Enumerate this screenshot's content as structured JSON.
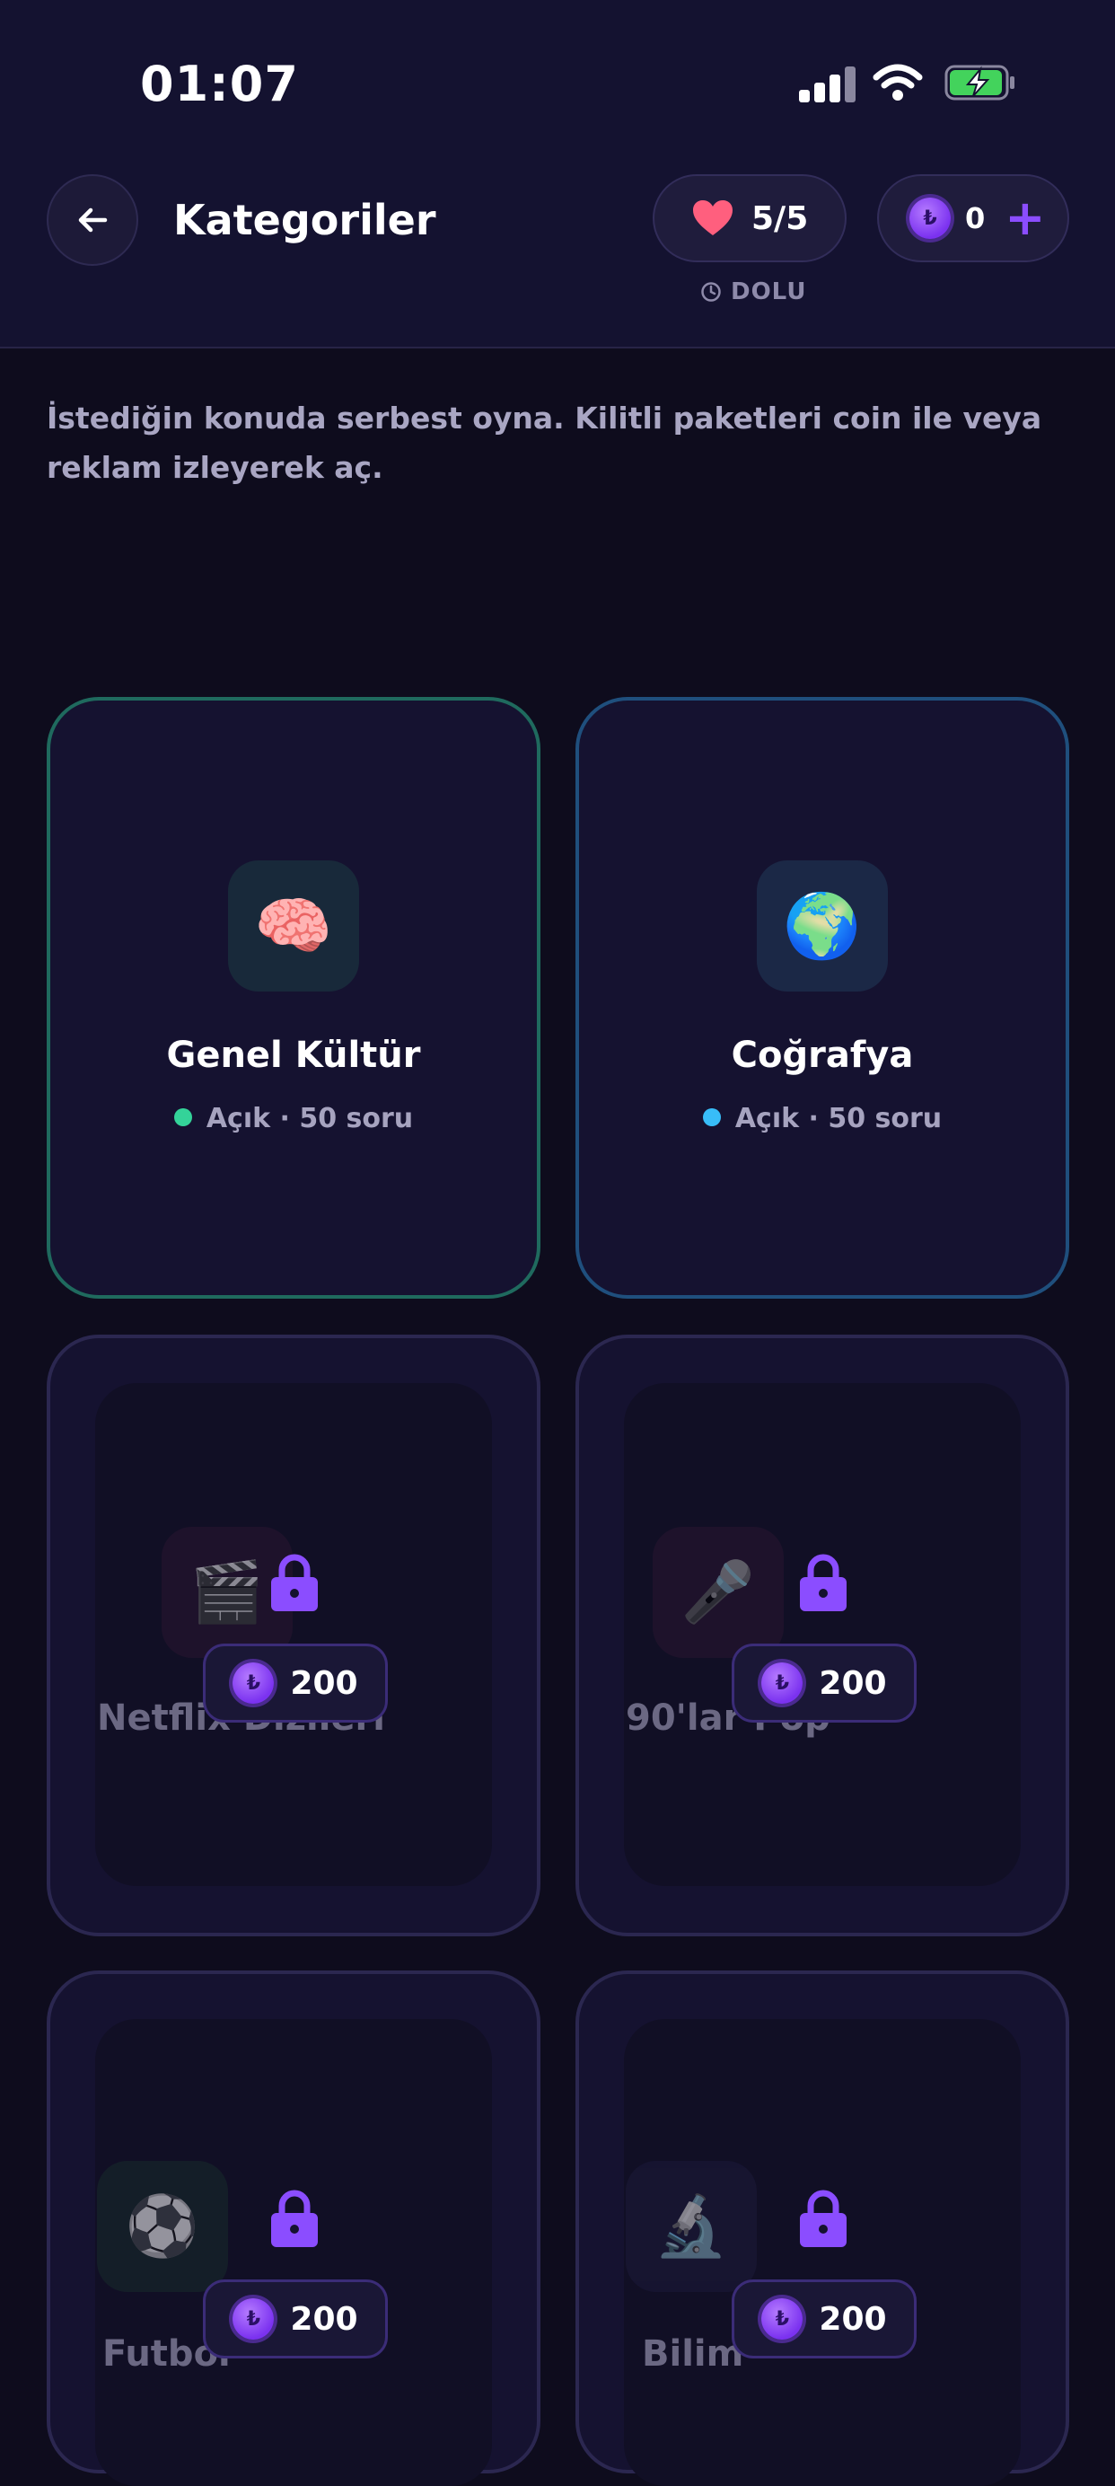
{
  "status_bar": {
    "time": "01:07"
  },
  "header": {
    "title": "Kategoriler",
    "lives": "5/5",
    "lives_status": "DOLU",
    "coins": "0",
    "add_coins_label": "+"
  },
  "intro_text": "İstediğin konuda serbest oyna. Kilitli paketleri coin ile veya reklam izleyerek aç.",
  "colors": {
    "accent": "#8b4dff",
    "open_green": "#34d399",
    "open_blue": "#38bdf8",
    "heart": "#ff5f7e"
  },
  "categories": [
    {
      "name": "Genel Kültür",
      "icon": "brain-icon",
      "emoji": "🧠",
      "status": "Açık · 50 soru",
      "locked": false
    },
    {
      "name": "Coğrafya",
      "icon": "globe-icon",
      "emoji": "🌍",
      "status": "Açık · 50 soru",
      "locked": false
    },
    {
      "name": "Netflix Dizileri",
      "icon": "clapperboard-icon",
      "emoji": "🎬",
      "price": "200",
      "locked": true
    },
    {
      "name": "90'lar Pop",
      "icon": "microphone-icon",
      "emoji": "🎤",
      "price": "200",
      "locked": true
    },
    {
      "name": "Futbol",
      "icon": "soccer-ball-icon",
      "emoji": "⚽",
      "price": "200",
      "locked": true
    },
    {
      "name": "Bilim",
      "icon": "microscope-icon",
      "emoji": "🔬",
      "price": "200",
      "locked": true
    }
  ]
}
